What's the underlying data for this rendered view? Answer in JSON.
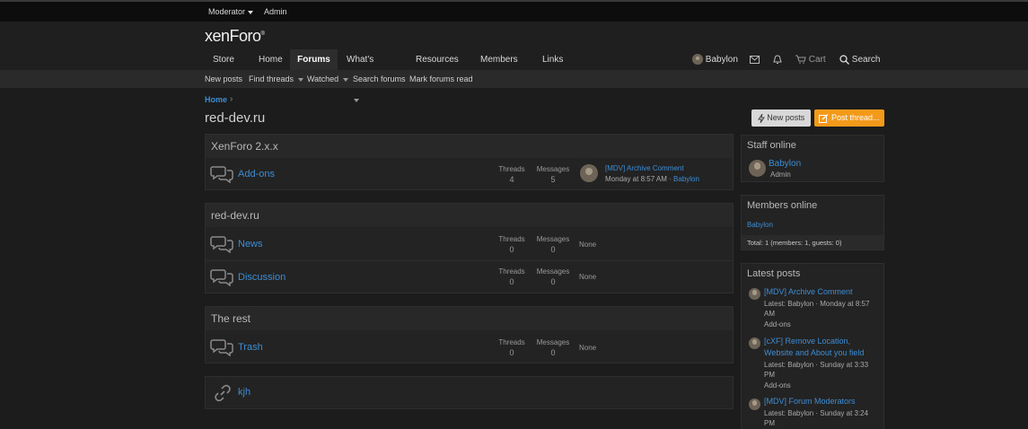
{
  "staffbar": {
    "moderator": "Moderator",
    "admin": "Admin"
  },
  "logo": {
    "text": "xenForo",
    "mark": "®"
  },
  "nav": {
    "store": "Store",
    "home": "Home",
    "forums": "Forums",
    "whats_new": "What's new",
    "resources": "Resources",
    "members": "Members",
    "links": "Links",
    "user": "Babylon",
    "cart": "Cart",
    "search": "Search"
  },
  "subnav": {
    "new_posts": "New posts",
    "find_threads": "Find threads",
    "watched": "Watched",
    "search_forums": "Search forums",
    "mark_read": "Mark forums read"
  },
  "breadcrumb": {
    "home": "Home",
    "sep": "›"
  },
  "page_title": "red-dev.ru",
  "buttons": {
    "new_posts": "New posts",
    "post_thread": "Post thread..."
  },
  "labels": {
    "threads": "Threads",
    "messages": "Messages",
    "none": "None"
  },
  "categories": [
    {
      "title": "XenForo 2.x.x",
      "forums": [
        {
          "name": "Add-ons",
          "threads": "4",
          "messages": "5",
          "last_title": "[MDV] Archive Comment",
          "last_time": "Monday at 8:57 AM",
          "last_user": "Babylon"
        }
      ]
    },
    {
      "title": "red-dev.ru",
      "forums": [
        {
          "name": "News",
          "threads": "0",
          "messages": "0"
        },
        {
          "name": "Discussion",
          "threads": "0",
          "messages": "0"
        }
      ]
    },
    {
      "title": "The rest",
      "forums": [
        {
          "name": "Trash",
          "threads": "0",
          "messages": "0"
        }
      ]
    }
  ],
  "link_forum": {
    "name": "kjh"
  },
  "staff_online": {
    "title": "Staff online",
    "name": "Babylon",
    "role": "Admin"
  },
  "members_online": {
    "title": "Members online",
    "name": "Babylon",
    "total": "Total: 1 (members: 1, guests: 0)"
  },
  "latest_posts": {
    "title": "Latest posts",
    "items": [
      {
        "title": "[MDV] Archive Comment",
        "meta": "Latest: Babylon · Monday at 8:57 AM",
        "forum": "Add-ons"
      },
      {
        "title": "[cXF] Remove Location, Website and About you field",
        "meta": "Latest: Babylon · Sunday at 3:33 PM",
        "forum": "Add-ons"
      },
      {
        "title": "[MDV] Forum Moderators",
        "meta": "Latest: Babylon · Sunday at 3:24 PM",
        "forum": ""
      }
    ]
  },
  "colors": {
    "accent": "#3c8dd4",
    "post_button": "#f49a1a",
    "background": "#1c1c1c"
  }
}
